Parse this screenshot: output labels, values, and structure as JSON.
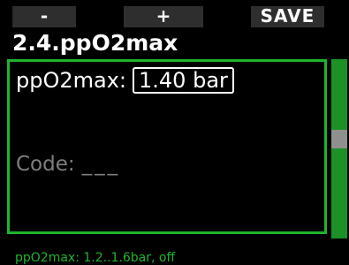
{
  "softkeys": {
    "minus_label": "-",
    "plus_label": "+",
    "save_label": "SAVE"
  },
  "header": {
    "title": "2.4.ppO2max"
  },
  "panel": {
    "ppo2_label": "ppO2max:",
    "ppo2_value": "1.40 bar",
    "code_label": "Code:",
    "code_value": "___"
  },
  "footer": {
    "hint": "ppO2max: 1.2..1.6bar, off"
  },
  "colors": {
    "accent": "#1fb42b",
    "scrollbar": "#1c9126",
    "softkey_bg": "#2e2e2e",
    "muted_text": "#7f7f7f",
    "background": "#000000"
  }
}
